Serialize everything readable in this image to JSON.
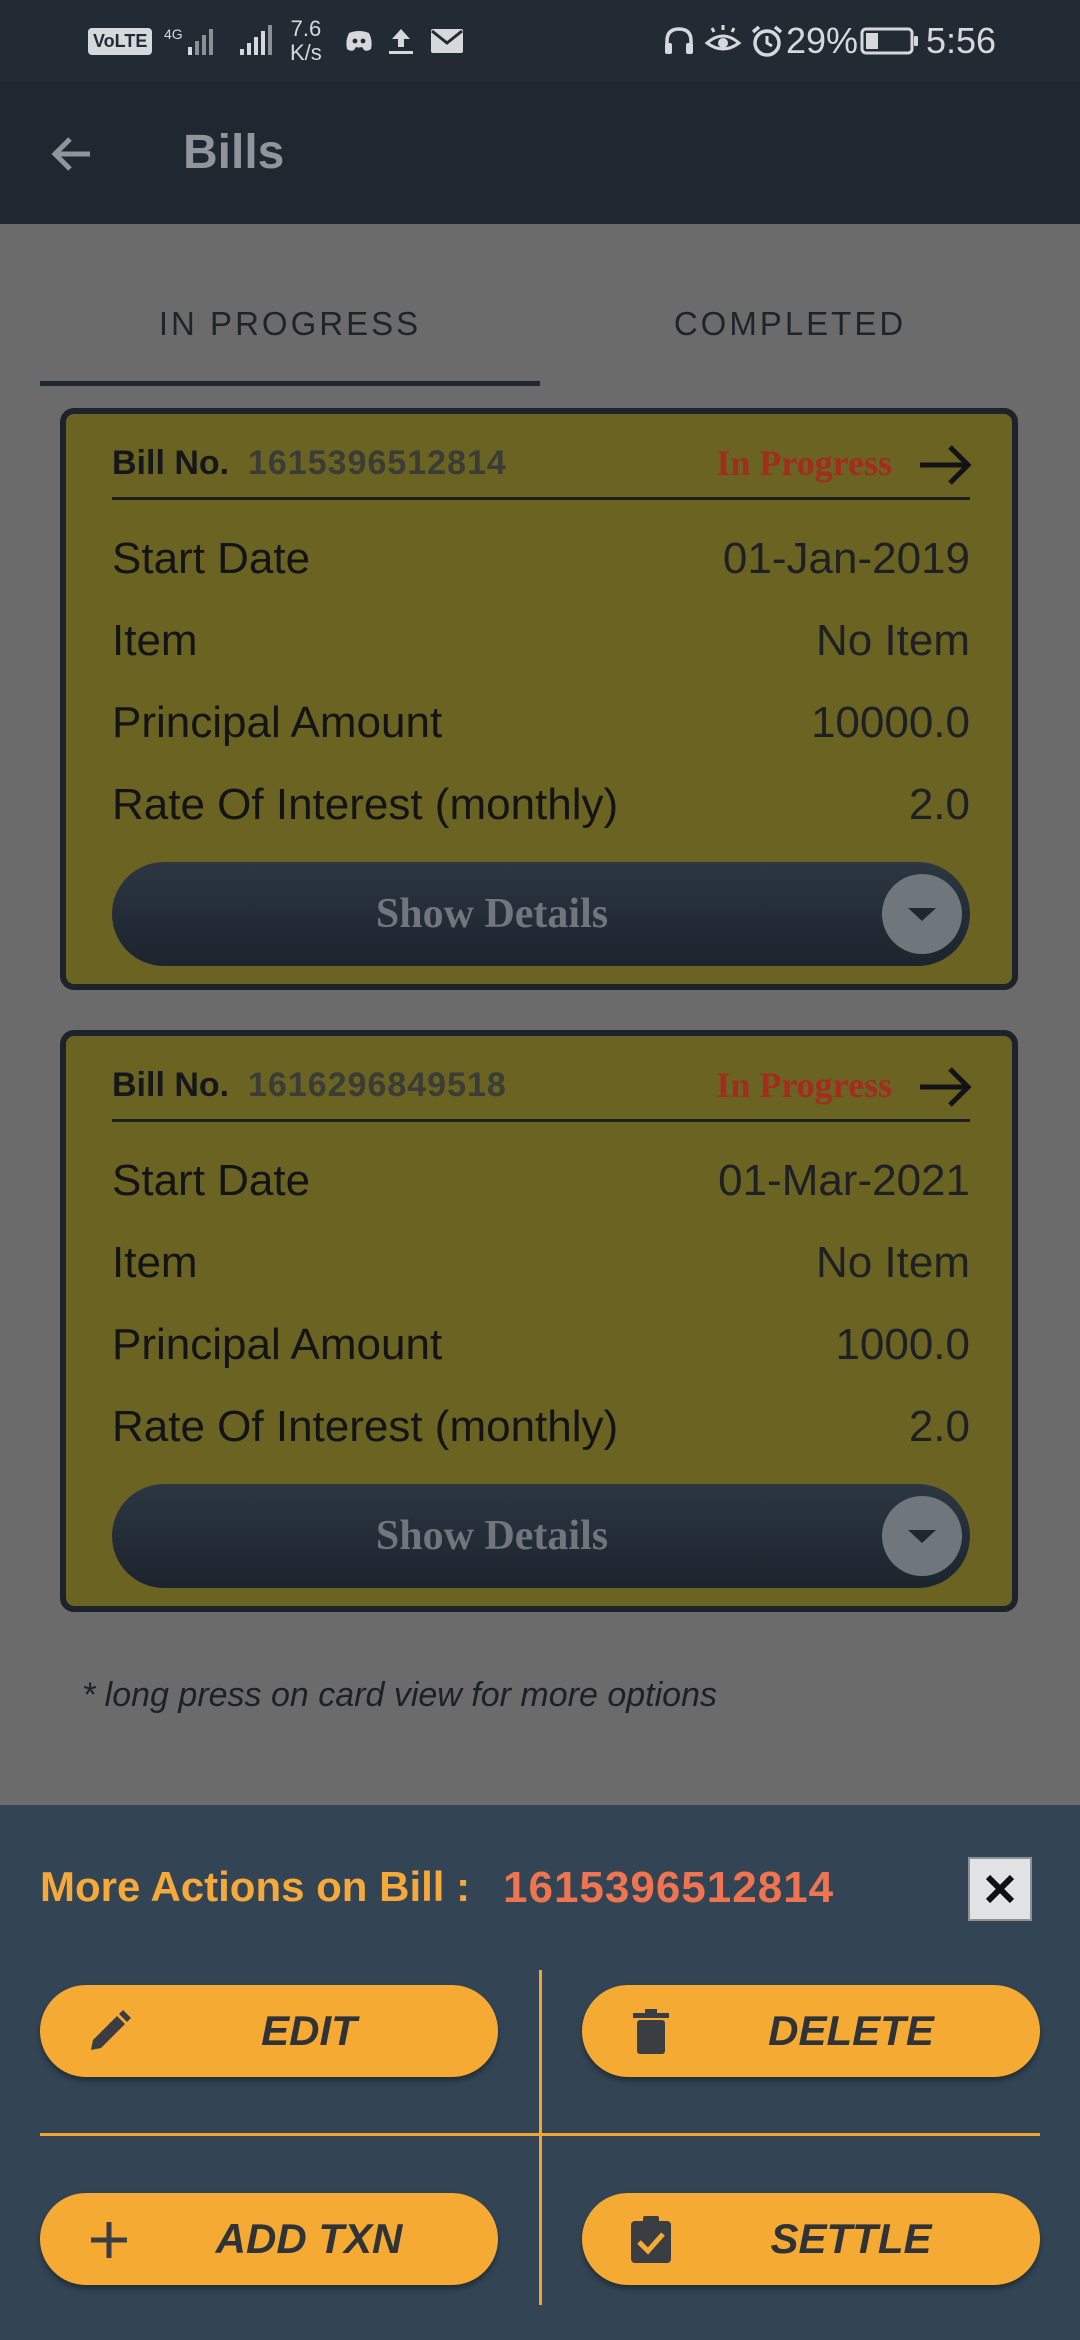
{
  "status_bar": {
    "volte": "VoLTE",
    "network": "4G",
    "speed_value": "7.6",
    "speed_unit": "K/s",
    "battery": "29%",
    "time": "5:56"
  },
  "app_bar": {
    "title": "Bills"
  },
  "tabs": [
    {
      "label": "IN PROGRESS",
      "selected": true
    },
    {
      "label": "COMPLETED",
      "selected": false
    }
  ],
  "bills": [
    {
      "bill_no_label": "Bill No.",
      "bill_no": "1615396512814",
      "status": "In Progress",
      "rows": [
        {
          "key": "Start Date",
          "value": "01-Jan-2019"
        },
        {
          "key": "Item",
          "value": "No Item"
        },
        {
          "key": "Principal Amount",
          "value": "10000.0"
        },
        {
          "key": "Rate Of Interest (monthly)",
          "value": "2.0"
        }
      ],
      "show_details": "Show Details"
    },
    {
      "bill_no_label": "Bill No.",
      "bill_no": "1616296849518",
      "status": "In Progress",
      "rows": [
        {
          "key": "Start Date",
          "value": "01-Mar-2021"
        },
        {
          "key": "Item",
          "value": "No Item"
        },
        {
          "key": "Principal Amount",
          "value": "1000.0"
        },
        {
          "key": "Rate Of Interest (monthly)",
          "value": "2.0"
        }
      ],
      "show_details": "Show Details"
    }
  ],
  "hint": "* long press on card view for more options",
  "sheet": {
    "title": "More Actions on Bill :",
    "bill_no": "1615396512814",
    "actions": {
      "edit": "EDIT",
      "delete": "DELETE",
      "add_txn": "ADD TXN",
      "settle": "SETTLE"
    }
  },
  "colors": {
    "status_bar": "#222b34",
    "app_bar": "#1f2731",
    "card_bg": "#6a6322",
    "status_text": "#a42c1d",
    "sheet_bg": "#334555",
    "accent": "#f5aa33",
    "sheet_bill": "#f0744f"
  }
}
